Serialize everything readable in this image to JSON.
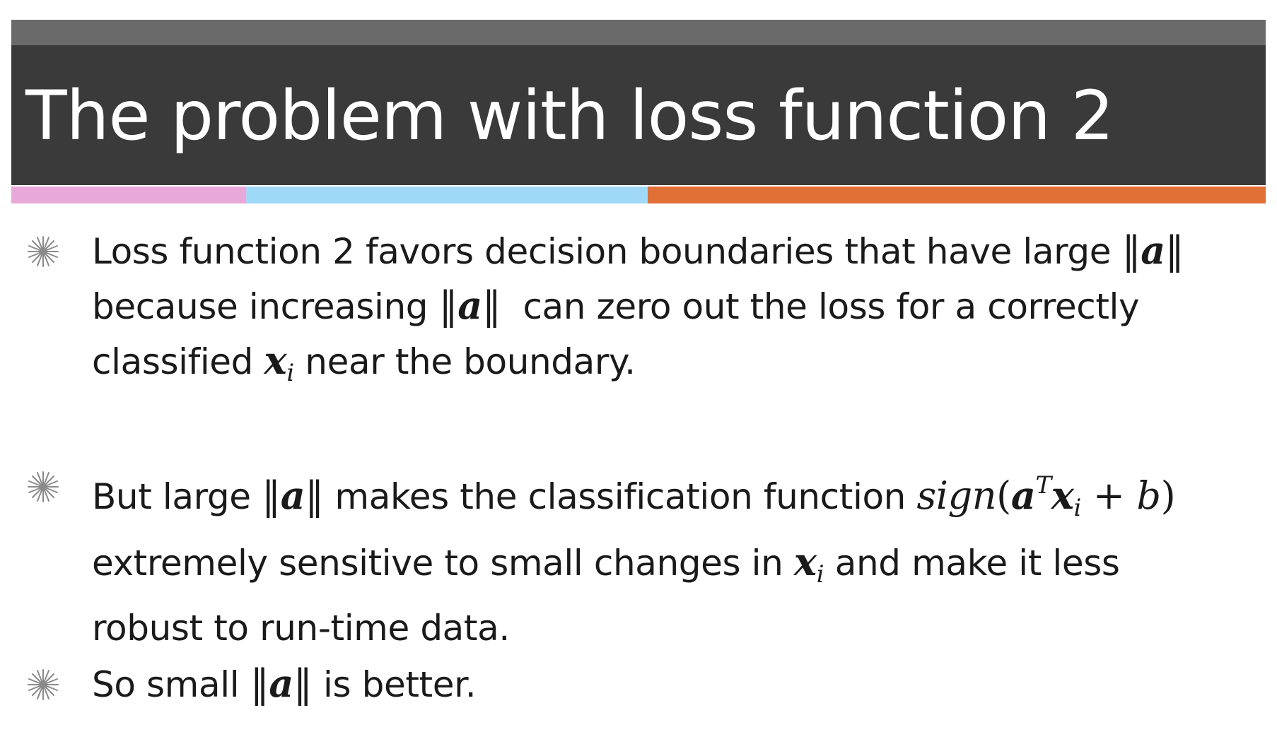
{
  "slide": {
    "title": "The problem with loss function 2",
    "colors": {
      "top_strip": "#6a6a6a",
      "title_bar": "#3a3a3a",
      "accent_pink": "#e8a9da",
      "accent_blue": "#a0d8f8",
      "accent_orange": "#e07035",
      "bullet_icon": "#8a8a8a"
    }
  },
  "bullets": [
    {
      "icon": "starburst-bullet-icon",
      "line1_text": "Loss function 2 favors decision boundaries that have large ",
      "line2_text_a": "because increasing ",
      "line2_text_b": "can zero out the loss for a correctly",
      "line3_text_a": "classified ",
      "line3_text_b": "near the boundary."
    },
    {
      "icon": "starburst-bullet-icon",
      "line1_text_a": "But large ",
      "line1_text_b": "makes the classification function ",
      "line2_text_a": "extremely sensitive to small changes in ",
      "line2_text_b": "and make it less",
      "line3_text": "robust to run-time data."
    },
    {
      "icon": "starburst-bullet-icon",
      "line1_text_a": "So small ",
      "line1_text_b": "is better."
    }
  ],
  "math": {
    "norm_bar": "‖",
    "vec_a": "a",
    "vec_x": "x",
    "sub_i": "i",
    "sup_T": "T",
    "sign_fn": "sign",
    "open_paren": "(",
    "close_paren": ")",
    "plus": " + ",
    "b": "b"
  }
}
